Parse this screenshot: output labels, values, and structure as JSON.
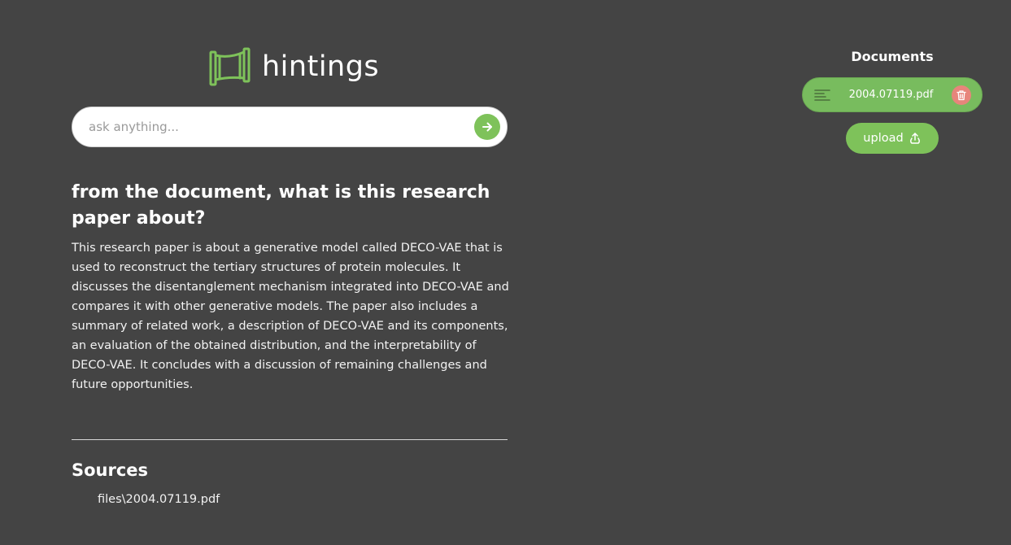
{
  "app": {
    "name": "hintings"
  },
  "search": {
    "placeholder": "ask anything..."
  },
  "conversation": {
    "question": "from the document, what is this research paper about?",
    "answer": "This research paper is about a generative model called DECO-VAE that is used to reconstruct the tertiary structures of protein molecules. It discusses the disentanglement mechanism integrated into DECO-VAE and compares it with other generative models. The paper also includes a summary of related work, a description of DECO-VAE and its components, an evaluation of the obtained distribution, and the interpretability of DECO-VAE. It concludes with a discussion of remaining challenges and future opportunities."
  },
  "sources": {
    "title": "Sources",
    "items": [
      "files\\2004.07119.pdf"
    ]
  },
  "documents": {
    "title": "Documents",
    "items": [
      {
        "name": "2004.07119.pdf",
        "menu_icon": "list-icon",
        "delete_icon": "trash-icon"
      }
    ],
    "upload_label": "upload",
    "upload_icon": "upload-icon"
  },
  "colors": {
    "background": "#444444",
    "accent_green": "#7ec25a",
    "delete_red": "#e7857b",
    "text": "#ffffff"
  }
}
